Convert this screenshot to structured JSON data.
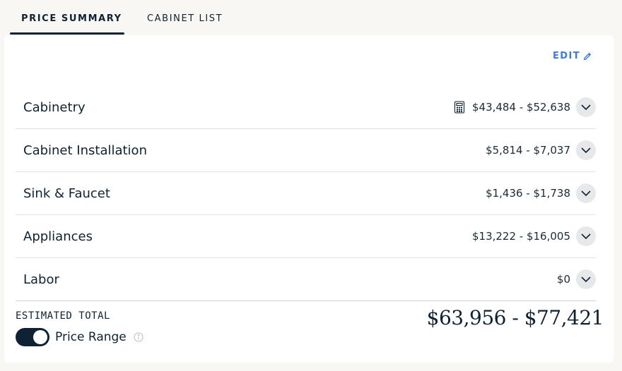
{
  "tabs": [
    {
      "label": "PRICE SUMMARY",
      "active": true
    },
    {
      "label": "CABINET LIST",
      "active": false
    }
  ],
  "edit_label": "EDIT",
  "rows": [
    {
      "label": "Cabinetry",
      "price": "$43,484 - $52,638",
      "icon": "calculator-icon"
    },
    {
      "label": "Cabinet Installation",
      "price": "$5,814 - $7,037"
    },
    {
      "label": "Sink & Faucet",
      "price": "$1,436 - $1,738"
    },
    {
      "label": "Appliances",
      "price": "$13,222 - $16,005"
    },
    {
      "label": "Labor",
      "price": "$0"
    }
  ],
  "estimated_total_label": "ESTIMATED TOTAL",
  "estimated_total_value": "$63,956 - $77,421",
  "price_range_label": "Price Range",
  "price_range_enabled": true,
  "colors": {
    "accent": "#3b7bd4",
    "dark": "#0f2233",
    "background": "#f8f7f3"
  }
}
